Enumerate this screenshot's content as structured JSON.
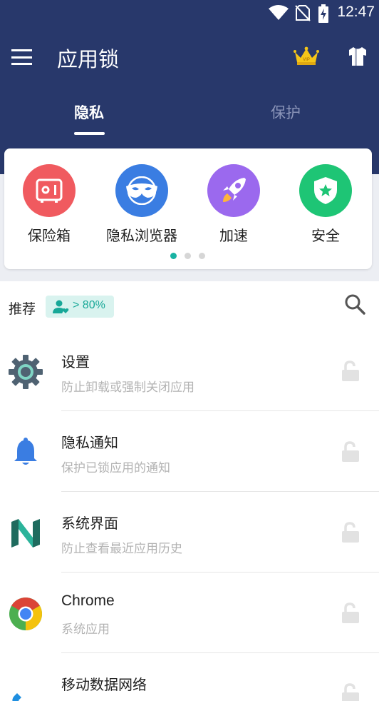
{
  "status_bar": {
    "time": "12:47",
    "icons": [
      "wifi-icon",
      "no-sim-icon",
      "battery-charging-icon"
    ]
  },
  "app_bar": {
    "title": "应用锁",
    "icons": [
      "menu-icon",
      "crown-vip-icon",
      "shirt-theme-icon"
    ],
    "crown_badge": "VIP"
  },
  "tabs": [
    {
      "label": "隐私",
      "selected": true
    },
    {
      "label": "保护",
      "selected": false
    }
  ],
  "features": [
    {
      "label": "保险箱",
      "icon": "safe-icon",
      "color": "#f05a5f"
    },
    {
      "label": "隐私浏览器",
      "icon": "mask-icon",
      "color": "#3a7de2"
    },
    {
      "label": "加速",
      "icon": "rocket-icon",
      "color": "#9b69ee"
    },
    {
      "label": "安全",
      "icon": "shield-star-icon",
      "color": "#1ec575"
    }
  ],
  "pager": {
    "count": 3,
    "active": 0,
    "active_color": "#19b3a3"
  },
  "recommend": {
    "label": "推荐",
    "badge_text": "> 80%"
  },
  "apps": [
    {
      "name": "设置",
      "desc": "防止卸载或强制关闭应用",
      "icon": "settings-gear-icon"
    },
    {
      "name": "隐私通知",
      "desc": "保护已锁应用的通知",
      "icon": "notification-bell-icon"
    },
    {
      "name": "系统界面",
      "desc": "防止查看最近应用历史",
      "icon": "android-n-icon"
    },
    {
      "name": "Chrome",
      "desc": "系统应用",
      "icon": "chrome-icon"
    },
    {
      "name": "移动数据网络",
      "desc": "",
      "icon": "phone-icon"
    }
  ],
  "colors": {
    "header": "#28386b",
    "accent": "#19b3a3",
    "lock": "#e2e2e2"
  }
}
